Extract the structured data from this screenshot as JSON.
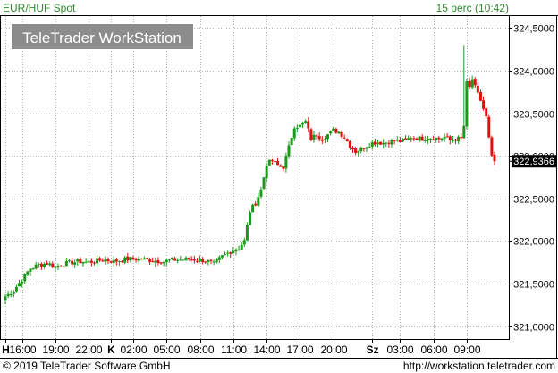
{
  "header": {
    "instrument": "EUR/HUF Spot",
    "period": "15 perc (10:42)"
  },
  "watermark": "TeleTrader WorkStation",
  "footer": {
    "copyright": "© 2019 TeleTrader Software GmbH",
    "url": "http://workstation.teletrader.com"
  },
  "colors": {
    "up": "#1a9a1a",
    "down": "#e01010",
    "grid": "#b4b4b4",
    "header_text": "#2e8b2e",
    "marker_bg": "#000000",
    "marker_text": "#ffffff",
    "watermark_bg": "#8c8c8c"
  },
  "last_price_label": "322,9366",
  "chart_data": {
    "type": "candlestick",
    "title": "EUR/HUF Spot",
    "y_axis": {
      "range": [
        320.85,
        324.65
      ],
      "ticks": [
        321.0,
        321.5,
        322.0,
        322.5,
        323.0,
        323.5,
        324.0,
        324.5
      ],
      "tick_labels": [
        "321,0000",
        "321,5000",
        "322,0000",
        "322,5000",
        "323,0000",
        "323,5000",
        "324,0000",
        "324,5000"
      ]
    },
    "x_axis": {
      "labels": [
        {
          "text": "H",
          "bold": true,
          "i": 0
        },
        {
          "text": "16:00",
          "i": 6
        },
        {
          "text": "19:00",
          "i": 18
        },
        {
          "text": "22:00",
          "i": 30
        },
        {
          "text": "K",
          "bold": true,
          "i": 38
        },
        {
          "text": "02:00",
          "i": 46
        },
        {
          "text": "05:00",
          "i": 58
        },
        {
          "text": "08:00",
          "i": 70
        },
        {
          "text": "11:00",
          "i": 82
        },
        {
          "text": "14:00",
          "i": 94
        },
        {
          "text": "17:00",
          "i": 106
        },
        {
          "text": "20:00",
          "i": 118
        },
        {
          "text": "Sz",
          "bold": true,
          "i": 132
        },
        {
          "text": "03:00",
          "i": 142
        },
        {
          "text": "06:00",
          "i": 154
        },
        {
          "text": "09:00",
          "i": 166
        }
      ],
      "count": 177
    },
    "last_price": 322.9366,
    "close_path": [
      [
        0,
        321.35
      ],
      [
        3,
        321.42
      ],
      [
        6,
        321.55
      ],
      [
        9,
        321.68
      ],
      [
        12,
        321.72
      ],
      [
        15,
        321.74
      ],
      [
        18,
        321.7
      ],
      [
        21,
        321.73
      ],
      [
        24,
        321.75
      ],
      [
        27,
        321.76
      ],
      [
        30,
        321.75
      ],
      [
        33,
        321.77
      ],
      [
        36,
        321.78
      ],
      [
        39,
        321.76
      ],
      [
        42,
        321.78
      ],
      [
        45,
        321.79
      ],
      [
        48,
        321.79
      ],
      [
        51,
        321.78
      ],
      [
        54,
        321.77
      ],
      [
        57,
        321.76
      ],
      [
        60,
        321.78
      ],
      [
        63,
        321.78
      ],
      [
        66,
        321.79
      ],
      [
        69,
        321.78
      ],
      [
        72,
        321.77
      ],
      [
        75,
        321.73
      ],
      [
        78,
        321.82
      ],
      [
        81,
        321.88
      ],
      [
        84,
        321.92
      ],
      [
        86,
        322.0
      ],
      [
        88,
        322.35
      ],
      [
        90,
        322.45
      ],
      [
        92,
        322.6
      ],
      [
        94,
        322.9
      ],
      [
        96,
        322.95
      ],
      [
        98,
        322.88
      ],
      [
        100,
        322.87
      ],
      [
        102,
        323.1
      ],
      [
        104,
        323.35
      ],
      [
        106,
        323.35
      ],
      [
        108,
        323.4
      ],
      [
        110,
        323.2
      ],
      [
        112,
        323.25
      ],
      [
        114,
        323.2
      ],
      [
        116,
        323.25
      ],
      [
        118,
        323.3
      ],
      [
        120,
        323.28
      ],
      [
        122,
        323.22
      ],
      [
        124,
        323.12
      ],
      [
        126,
        323.05
      ],
      [
        128,
        323.08
      ],
      [
        130,
        323.12
      ],
      [
        132,
        323.15
      ],
      [
        134,
        323.16
      ],
      [
        136,
        323.15
      ],
      [
        138,
        323.17
      ],
      [
        140,
        323.18
      ],
      [
        142,
        323.17
      ],
      [
        144,
        323.18
      ],
      [
        146,
        323.22
      ],
      [
        148,
        323.21
      ],
      [
        150,
        323.2
      ],
      [
        152,
        323.22
      ],
      [
        154,
        323.21
      ],
      [
        156,
        323.2
      ],
      [
        158,
        323.22
      ],
      [
        160,
        323.18
      ],
      [
        162,
        323.2
      ],
      [
        164,
        323.2
      ],
      [
        165,
        323.35
      ],
      [
        166,
        323.85
      ],
      [
        167,
        323.8
      ],
      [
        168,
        323.9
      ],
      [
        169,
        323.8
      ],
      [
        170,
        323.72
      ],
      [
        171,
        323.65
      ],
      [
        172,
        323.55
      ],
      [
        173,
        323.45
      ],
      [
        174,
        323.2
      ],
      [
        175,
        322.98
      ],
      [
        176,
        322.94
      ]
    ],
    "wicks": [
      {
        "i": 165,
        "high": 324.3,
        "low": 323.3
      }
    ]
  }
}
